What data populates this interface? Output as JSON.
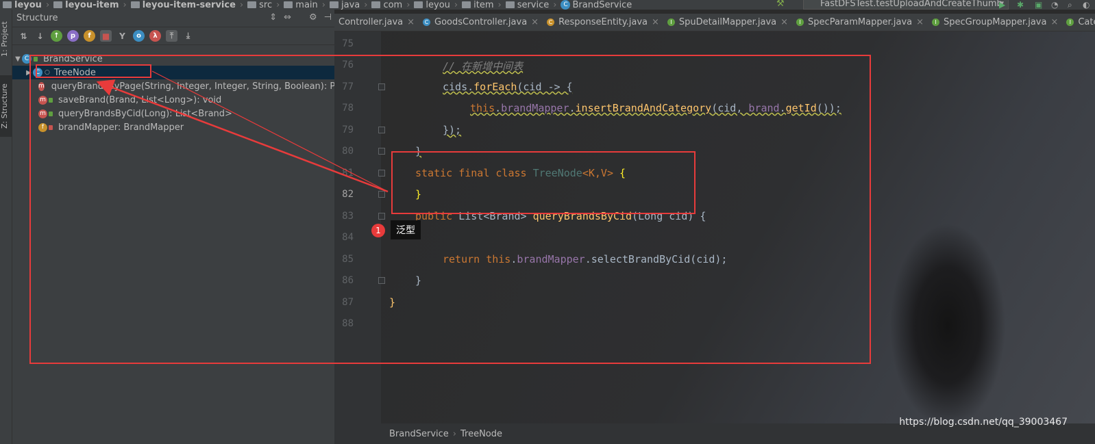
{
  "breadcrumb": [
    "leyou",
    "leyou-item",
    "leyou-item-service",
    "src",
    "main",
    "java",
    "com",
    "leyou",
    "item",
    "service",
    "BrandService"
  ],
  "run_config": "FastDFSTest.testUploadAndCreateThumb",
  "structure": {
    "title": "Structure",
    "root": "BrandService",
    "items": [
      {
        "label": "TreeNode",
        "kind": "class"
      },
      {
        "label": "queryBrandsByPage(String, Integer, Integer, String, Boolean): Page",
        "kind": "method"
      },
      {
        "label": "saveBrand(Brand, List<Long>): void",
        "kind": "method"
      },
      {
        "label": "queryBrandsByCid(Long): List<Brand>",
        "kind": "method"
      },
      {
        "label": "brandMapper: BrandMapper",
        "kind": "field"
      }
    ]
  },
  "stripe": {
    "project": "1: Project",
    "structure": "Z: Structure"
  },
  "tabs": [
    "Controller.java",
    "GoodsController.java",
    "ResponseEntity.java",
    "SpuDetailMapper.java",
    "SpecParamMapper.java",
    "SpecGroupMapper.java",
    "Catego"
  ],
  "line_numbers": [
    "75",
    "76",
    "77",
    "78",
    "79",
    "80",
    "81",
    "82",
    "83",
    "84",
    "85",
    "86",
    "87",
    "88"
  ],
  "status": {
    "crumb1": "BrandService",
    "crumb2": "TreeNode"
  },
  "annotation": {
    "badge": "1",
    "tooltip": "泛型"
  },
  "watermark": "https://blog.csdn.net/qq_39003467",
  "code": {
    "comment": "// 在新增中间表",
    "l77_a": "cids.",
    "l77_m": "forEach",
    "l77_b": "(cid -> {",
    "l78_this": "this",
    "l78_dot": ".",
    "l78_field": "brandMapper",
    "l78_dot2": ".",
    "l78_m": "insertBrandAndCategory",
    "l78_rest1": "(cid, ",
    "l78_brand": "brand",
    "l78_dot3": ".",
    "l78_get": "getId",
    "l78_rest2": "());",
    "l79": "});",
    "l80": "}",
    "l81_kw": "static final class ",
    "l81_name": "TreeNode",
    "l81_gen": "<K,V>",
    "l81_brace": " {",
    "l82": "}",
    "l83_kw": "public ",
    "l83_type": "List<Brand> ",
    "l83_m": "queryBrandsByCid",
    "l83_rest": "(Long cid) {",
    "l85_kw": "return ",
    "l85_this": "this",
    "l85_dot": ".",
    "l85_field": "brandMapper",
    "l85_rest": ".selectBrandByCid(cid);",
    "l86": "}",
    "l87": "}"
  },
  "colors": {
    "accent_red": "#e83b3b",
    "keyword": "#cc7832",
    "field": "#9876aa",
    "method": "#ffc66d"
  }
}
